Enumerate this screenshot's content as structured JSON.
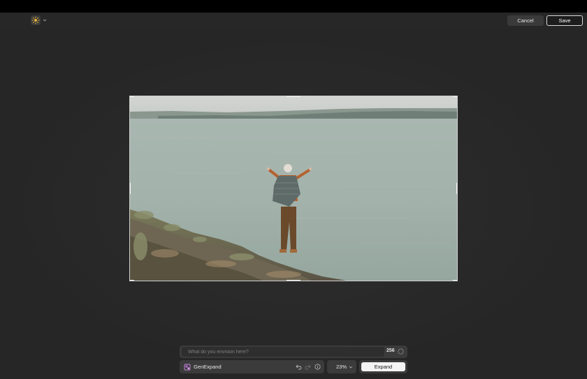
{
  "toolbar": {
    "cancel_label": "Cancel",
    "save_label": "Save",
    "logo_icon": "sun-icon",
    "menu_icon": "chevron-down-icon"
  },
  "prompt": {
    "placeholder": "What do you envision here?",
    "value": "",
    "credits": "256",
    "credits_icon": "credit-coin-icon"
  },
  "tools": {
    "genexpand_label": "GenExpand",
    "genexpand_icon": "genexpand-icon",
    "undo_icon": "undo-icon",
    "redo_icon": "redo-icon",
    "info_icon": "info-icon"
  },
  "zoom": {
    "value": "23%",
    "icon": "chevron-down-icon"
  },
  "actions": {
    "expand_label": "Expand"
  },
  "colors": {
    "background": "#272727",
    "panel": "#3b3b3b",
    "expand_button": "#f4f4f4",
    "logo_accent": "#e8b43a"
  }
}
